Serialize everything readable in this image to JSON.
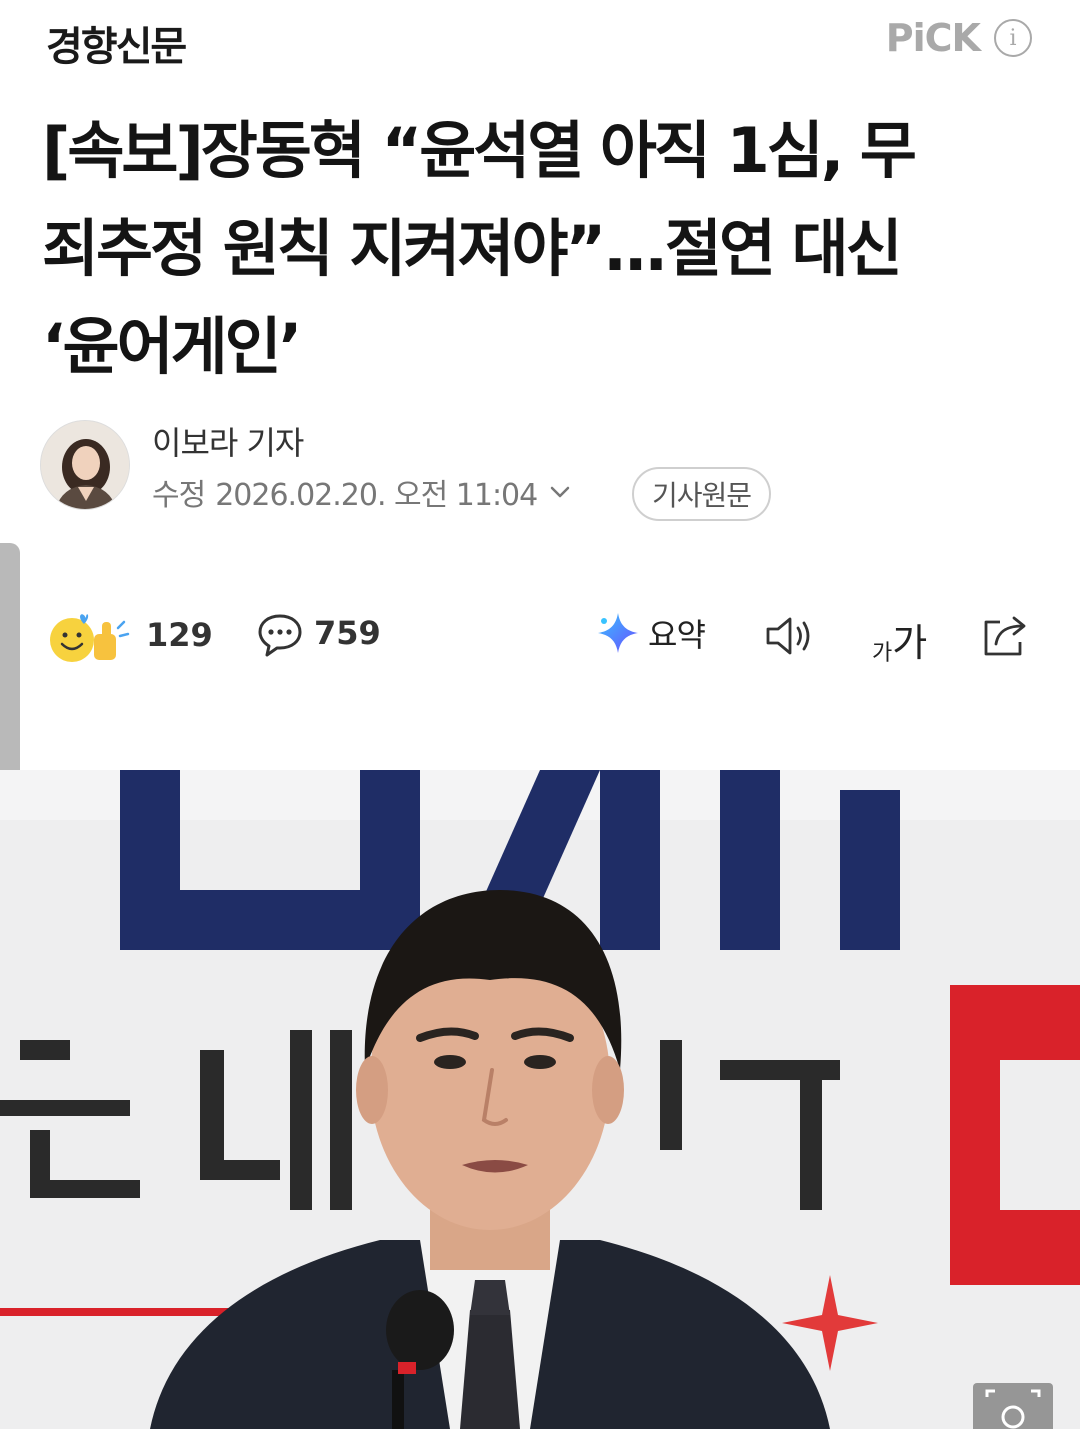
{
  "header": {
    "publisher": "경향신문",
    "pick_label": "PiCK",
    "info_icon": "info-icon"
  },
  "article": {
    "headline_lines": [
      "[속보]장동혁 “윤석열 아직 1심, 무",
      "죄추정 원칙 지켜져야”...절연 대신",
      "‘윤어게인’"
    ],
    "reporter": "이보라 기자",
    "date_label": "수정",
    "date_value": "2026.02.20. 오전 11:04",
    "original_button": "기사원문"
  },
  "toolbar": {
    "reaction_icon": "smile-thumbs-icon",
    "reaction_count": "129",
    "comment_icon": "comment-bubble-icon",
    "comment_count": "759",
    "summary_icon": "sparkle-icon",
    "summary_label": "요약",
    "audio_icon": "speaker-icon",
    "fontsize_small": "가",
    "fontsize_big": "가",
    "share_icon": "share-icon"
  },
  "colors": {
    "headline": "#141414",
    "muted": "#777777",
    "pick": "#a9a9a9",
    "banner_navy": "#1f2d66",
    "banner_red": "#d9222a"
  }
}
